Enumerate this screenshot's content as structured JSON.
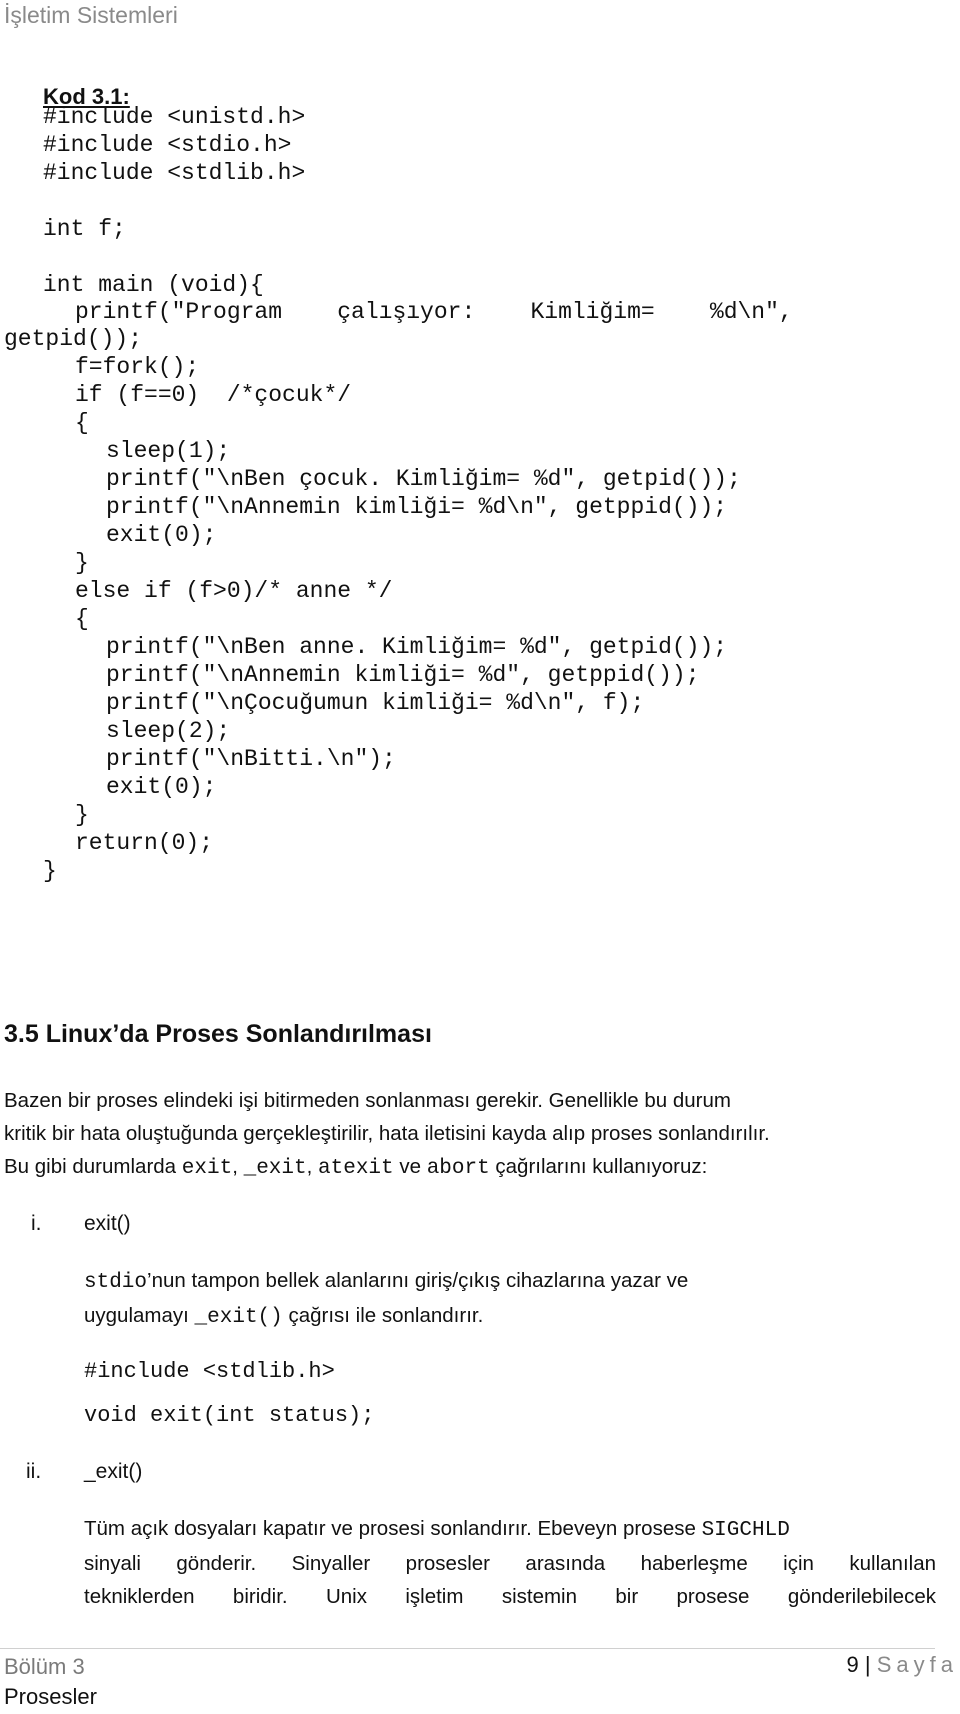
{
  "header": {
    "title": "İşletim Sistemleri"
  },
  "code_block": {
    "label": "Kod 3.1:",
    "lines": [
      "#include <unistd.h>",
      "#include <stdio.h>",
      "#include <stdlib.h>",
      "int f;",
      "int main (void){",
      "printf(\"Program    çalışıyor:    Kimliğim=    %d\\n\",",
      "getpid());",
      "f=fork();",
      "if (f==0)  /*çocuk*/",
      "{",
      "sleep(1);",
      "printf(\"\\nBen çocuk. Kimliğim= %d\", getpid());",
      "printf(\"\\nAnnemin kimliği= %d\\n\", getppid());",
      "exit(0);",
      "}",
      "else if (f>0)/* anne */",
      "{",
      "printf(\"\\nBen anne. Kimliğim= %d\", getpid());",
      "printf(\"\\nAnnemin kimliği= %d\", getppid());",
      "printf(\"\\nÇocuğumun kimliği= %d\\n\", f);",
      "sleep(2);",
      "printf(\"\\nBitti.\\n\");",
      "exit(0);",
      "}",
      "return(0);",
      "}"
    ]
  },
  "section": {
    "heading": "3.5 Linux’da Proses Sonlandırılması",
    "intro": {
      "line1": "Bazen bir proses elindeki işi bitirmeden sonlanması gerekir. Genellikle bu durum",
      "line2": "kritik bir hata oluştuğunda gerçekleştirilir, hata iletisini kayda alıp proses sonlandırılır.",
      "line3_prefix": "Bu gibi durumlarda ",
      "call1": "exit",
      "sep1": ", ",
      "call2": "_exit",
      "sep2": ", ",
      "call3": "atexit",
      "sep3": " ve ",
      "call4": "abort",
      "line3_suffix": " çağrılarını kullanıyoruz:"
    },
    "items": [
      {
        "number": "i.",
        "title": "exit()",
        "desc_code1": "stdio",
        "desc_text1": "’nun tampon bellek alanlarını giriş/çıkış cihazlarına yazar ve",
        "desc_text2": "uygulamayı ",
        "desc_code2": "_exit()",
        "desc_text3": " çağrısı ile sonlandırır.",
        "code_include": "#include <stdlib.h>",
        "code_proto": "void exit(int status);"
      },
      {
        "number": "ii.",
        "title": "_exit()",
        "desc_text1": "Tüm açık dosyaları kapatır ve prosesi sonlandırır. Ebeveyn prosese ",
        "desc_code1": "SIGCHLD",
        "desc_text2": "sinyali gönderir. Sinyaller prosesler arasında haberleşme için kullanılan",
        "desc_text3": "tekniklerden biridir. Unix işletim sistemin bir prosese gönderilebilecek"
      }
    ]
  },
  "footer": {
    "chapter": "Bölüm 3",
    "chapter_title": "Prosesler",
    "page_number": "9",
    "separator": "|",
    "page_word": "Sayfa"
  }
}
